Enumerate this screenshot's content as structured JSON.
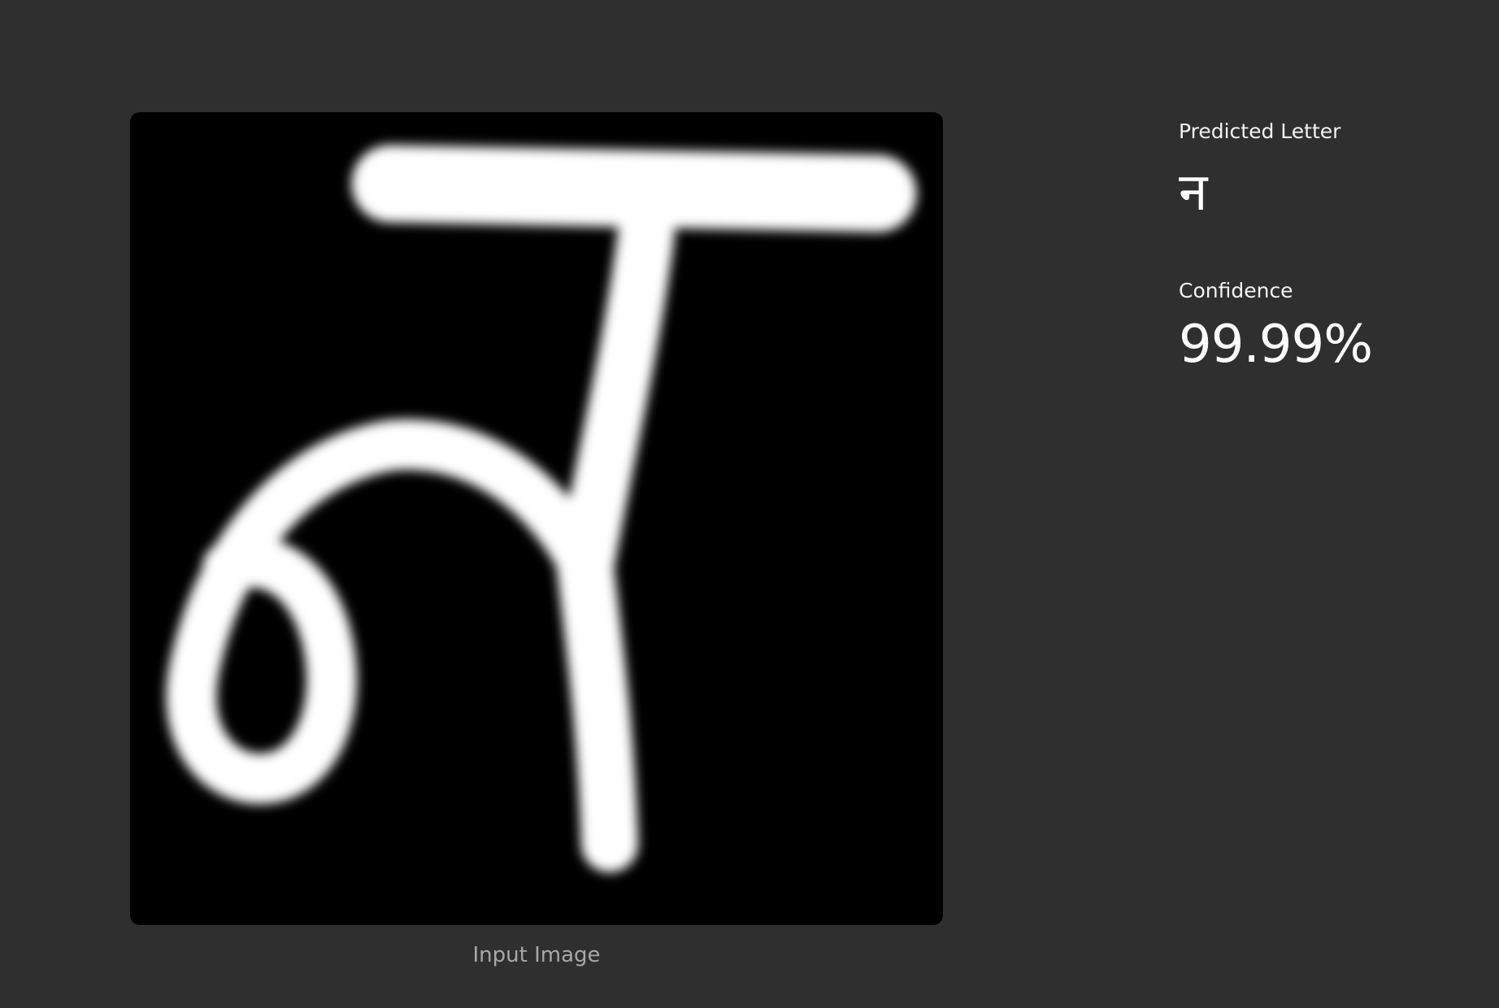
{
  "input": {
    "caption": "Input Image",
    "image_icon": "handwritten-devanagari-na-glyph"
  },
  "prediction": {
    "label": "Predicted Letter",
    "value": "न"
  },
  "confidence": {
    "label": "Confidence",
    "value": "99.99%"
  },
  "colors": {
    "background": "#2f2f2f",
    "image_background": "#000000",
    "stroke": "#ffffff",
    "caption": "#a8a8a8"
  }
}
